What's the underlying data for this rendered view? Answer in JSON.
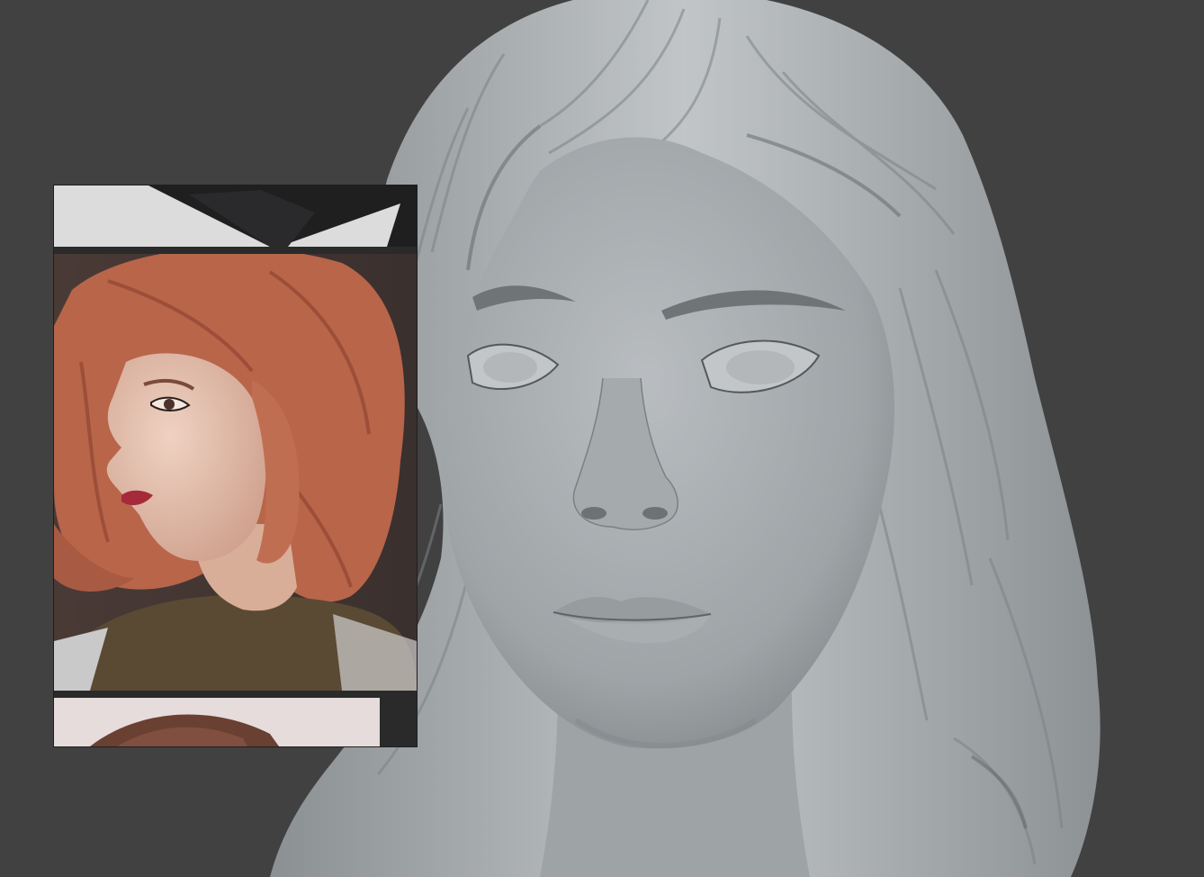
{
  "app": {
    "scene": "sculpt-viewport",
    "background_color": "#414141",
    "clay_color": "#a9adb0"
  },
  "viewport": {
    "model": {
      "icon": "sculpted-head-bust"
    }
  },
  "reference_panel": {
    "images": [
      {
        "icon": "reference-image-top-crop"
      },
      {
        "icon": "reference-photo-red-haired-woman"
      },
      {
        "icon": "reference-image-bottom-crop"
      }
    ],
    "colors": {
      "hair": "#b8654a",
      "skin": "#e4c2b0",
      "lips": "#a52a3a",
      "sweater": "#5a4a33"
    }
  }
}
